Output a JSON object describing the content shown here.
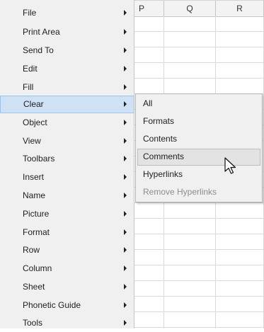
{
  "columns": [
    "P",
    "Q",
    "R"
  ],
  "menu": {
    "items": [
      {
        "label": "File",
        "has_submenu": true
      },
      {
        "label": "Print Area",
        "has_submenu": true
      },
      {
        "label": "Send To",
        "has_submenu": true
      },
      {
        "label": "Edit",
        "has_submenu": true
      },
      {
        "label": "Fill",
        "has_submenu": true
      },
      {
        "label": "Clear",
        "has_submenu": true,
        "highlighted": true
      },
      {
        "label": "Object",
        "has_submenu": true
      },
      {
        "label": "View",
        "has_submenu": true
      },
      {
        "label": "Toolbars",
        "has_submenu": true
      },
      {
        "label": "Insert",
        "has_submenu": true
      },
      {
        "label": "Name",
        "has_submenu": true
      },
      {
        "label": "Picture",
        "has_submenu": true
      },
      {
        "label": "Format",
        "has_submenu": true
      },
      {
        "label": "Row",
        "has_submenu": true
      },
      {
        "label": "Column",
        "has_submenu": true
      },
      {
        "label": "Sheet",
        "has_submenu": true
      },
      {
        "label": "Phonetic Guide",
        "has_submenu": true
      },
      {
        "label": "Tools",
        "has_submenu": true
      }
    ]
  },
  "submenu": {
    "items": [
      {
        "label": "All"
      },
      {
        "label": "Formats"
      },
      {
        "label": "Contents"
      },
      {
        "label": "Comments",
        "highlighted": true
      },
      {
        "label": "Hyperlinks"
      },
      {
        "label": "Remove Hyperlinks",
        "disabled": true
      }
    ]
  },
  "colors": {
    "menu_bg": "#f0f0f0",
    "highlight": "#cfe1f5",
    "highlight_border": "#9fc2e8",
    "disabled_text": "#8d8d8d"
  },
  "icons": {
    "submenu_arrow": "chevron-right-icon",
    "cursor": "mouse-pointer-icon"
  }
}
